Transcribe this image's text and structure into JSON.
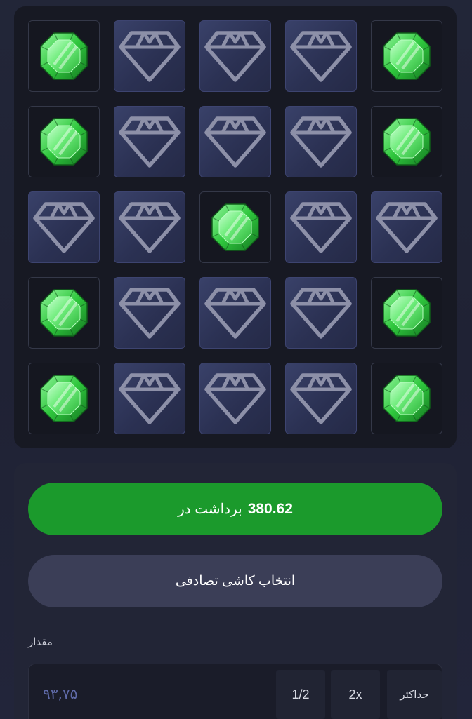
{
  "colors": {
    "accent_green": "#1b9a2c",
    "tile_hidden": "#2f3658",
    "tile_revealed": "#151720",
    "outline_icon": "#8d90a8",
    "gem_green": "#3ddc4a"
  },
  "board": {
    "rows": [
      [
        "gem",
        "hidden",
        "hidden",
        "hidden",
        "gem"
      ],
      [
        "gem",
        "hidden",
        "hidden",
        "hidden",
        "gem"
      ],
      [
        "hidden",
        "hidden",
        "gem",
        "hidden",
        "hidden"
      ],
      [
        "gem",
        "hidden",
        "hidden",
        "hidden",
        "gem"
      ],
      [
        "gem",
        "hidden",
        "hidden",
        "hidden",
        "gem"
      ]
    ],
    "icons": {
      "gem": "emerald-gem-icon",
      "hidden": "diamond-outline-icon"
    }
  },
  "controls": {
    "cashout_amount": "380.62",
    "cashout_label": "برداشت در",
    "random_tile_label": "انتخاب کاشی تصادفی",
    "amount_label": "مقدار",
    "amount_value": "۹۳,۷۵",
    "half_label": "1/2",
    "double_label": "2x",
    "max_label": "حداکثر"
  }
}
